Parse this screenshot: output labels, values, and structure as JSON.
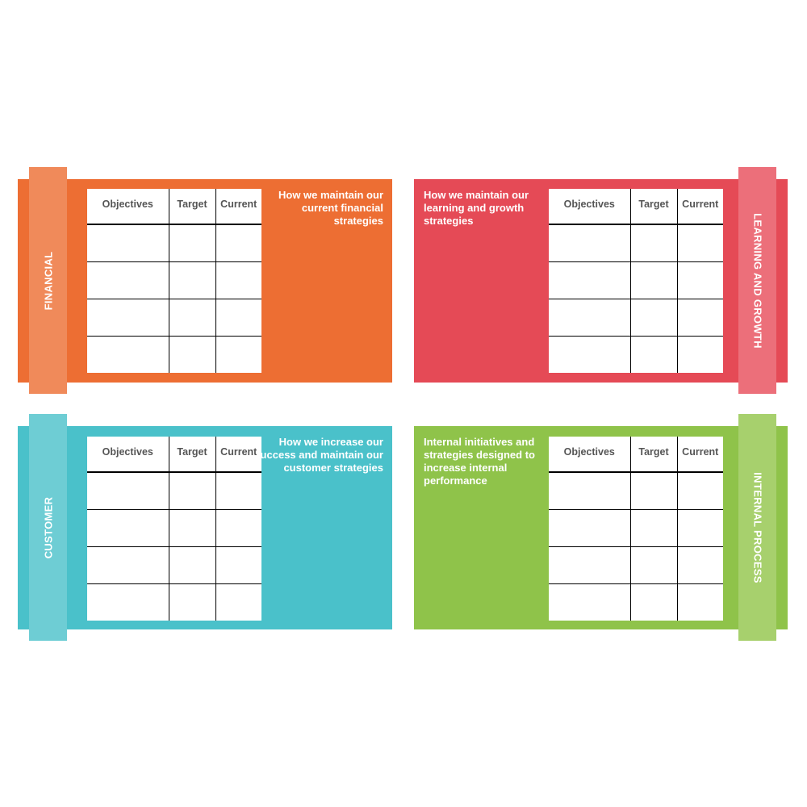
{
  "columns": [
    "Objectives",
    "Target",
    "Current"
  ],
  "quadrants": {
    "financial": {
      "label": "FINANCIAL",
      "description": "How we maintain our current financial strategies",
      "panel_color": "#ED6E33",
      "tab_color": "#F08A5A"
    },
    "learning": {
      "label": "LEARNING AND GROWTH",
      "description": "How we maintain our learning and growth strategies",
      "panel_color": "#E54A56",
      "tab_color": "#EC6F7A"
    },
    "customer": {
      "label": "CUSTOMER",
      "description": "How we increase our success and maintain our customer strategies",
      "panel_color": "#4AC1CA",
      "tab_color": "#6ECDD4"
    },
    "internal": {
      "label": "INTERNAL PROCESS",
      "description": "Internal initiatives and strategies designed to increase internal performance",
      "panel_color": "#8FC34A",
      "tab_color": "#A7D06D"
    }
  }
}
